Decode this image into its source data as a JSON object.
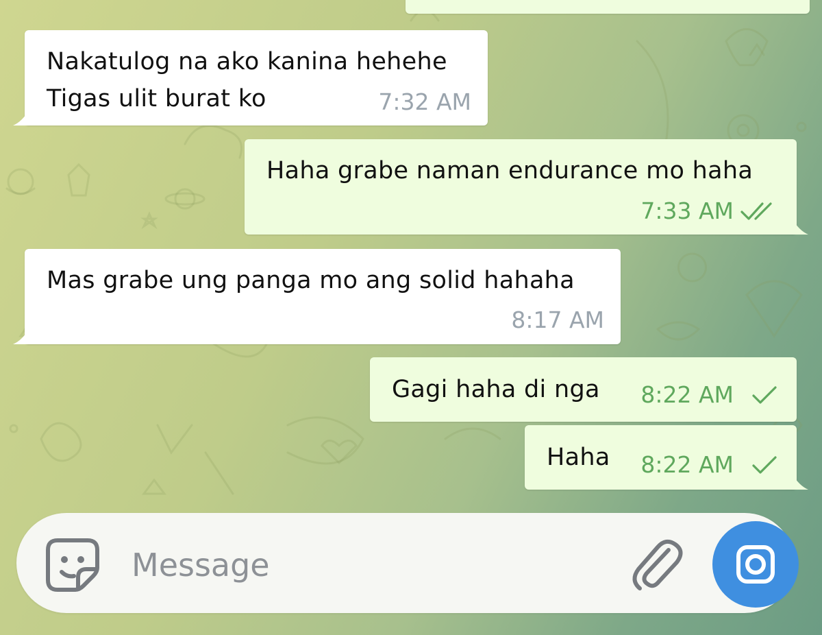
{
  "messages": [
    {
      "direction": "incoming",
      "lines": [
        "Nakatulog na ako kanina hehehe",
        "Tigas ulit burat ko"
      ],
      "time": "7:32 AM"
    },
    {
      "direction": "outgoing",
      "lines": [
        "Haha grabe naman endurance mo haha"
      ],
      "time": "7:33 AM",
      "status": "read"
    },
    {
      "direction": "incoming",
      "lines": [
        "Mas grabe ung panga mo ang solid hahaha"
      ],
      "time": "8:17 AM"
    },
    {
      "direction": "outgoing",
      "lines": [
        "Gagi haha di nga"
      ],
      "time": "8:22 AM",
      "status": "sent"
    },
    {
      "direction": "outgoing",
      "lines": [
        "Haha"
      ],
      "time": "8:22 AM",
      "status": "sent"
    }
  ],
  "composer": {
    "placeholder": "Message",
    "icons": {
      "sticker": "sticker-icon",
      "attach": "paperclip-icon",
      "camera": "camera-icon"
    }
  },
  "colors": {
    "incoming_bubble": "#ffffff",
    "outgoing_bubble": "#effdde",
    "outgoing_time": "#5fa85d",
    "incoming_time": "#9aa4ad",
    "camera_button": "#3f8fe0"
  }
}
